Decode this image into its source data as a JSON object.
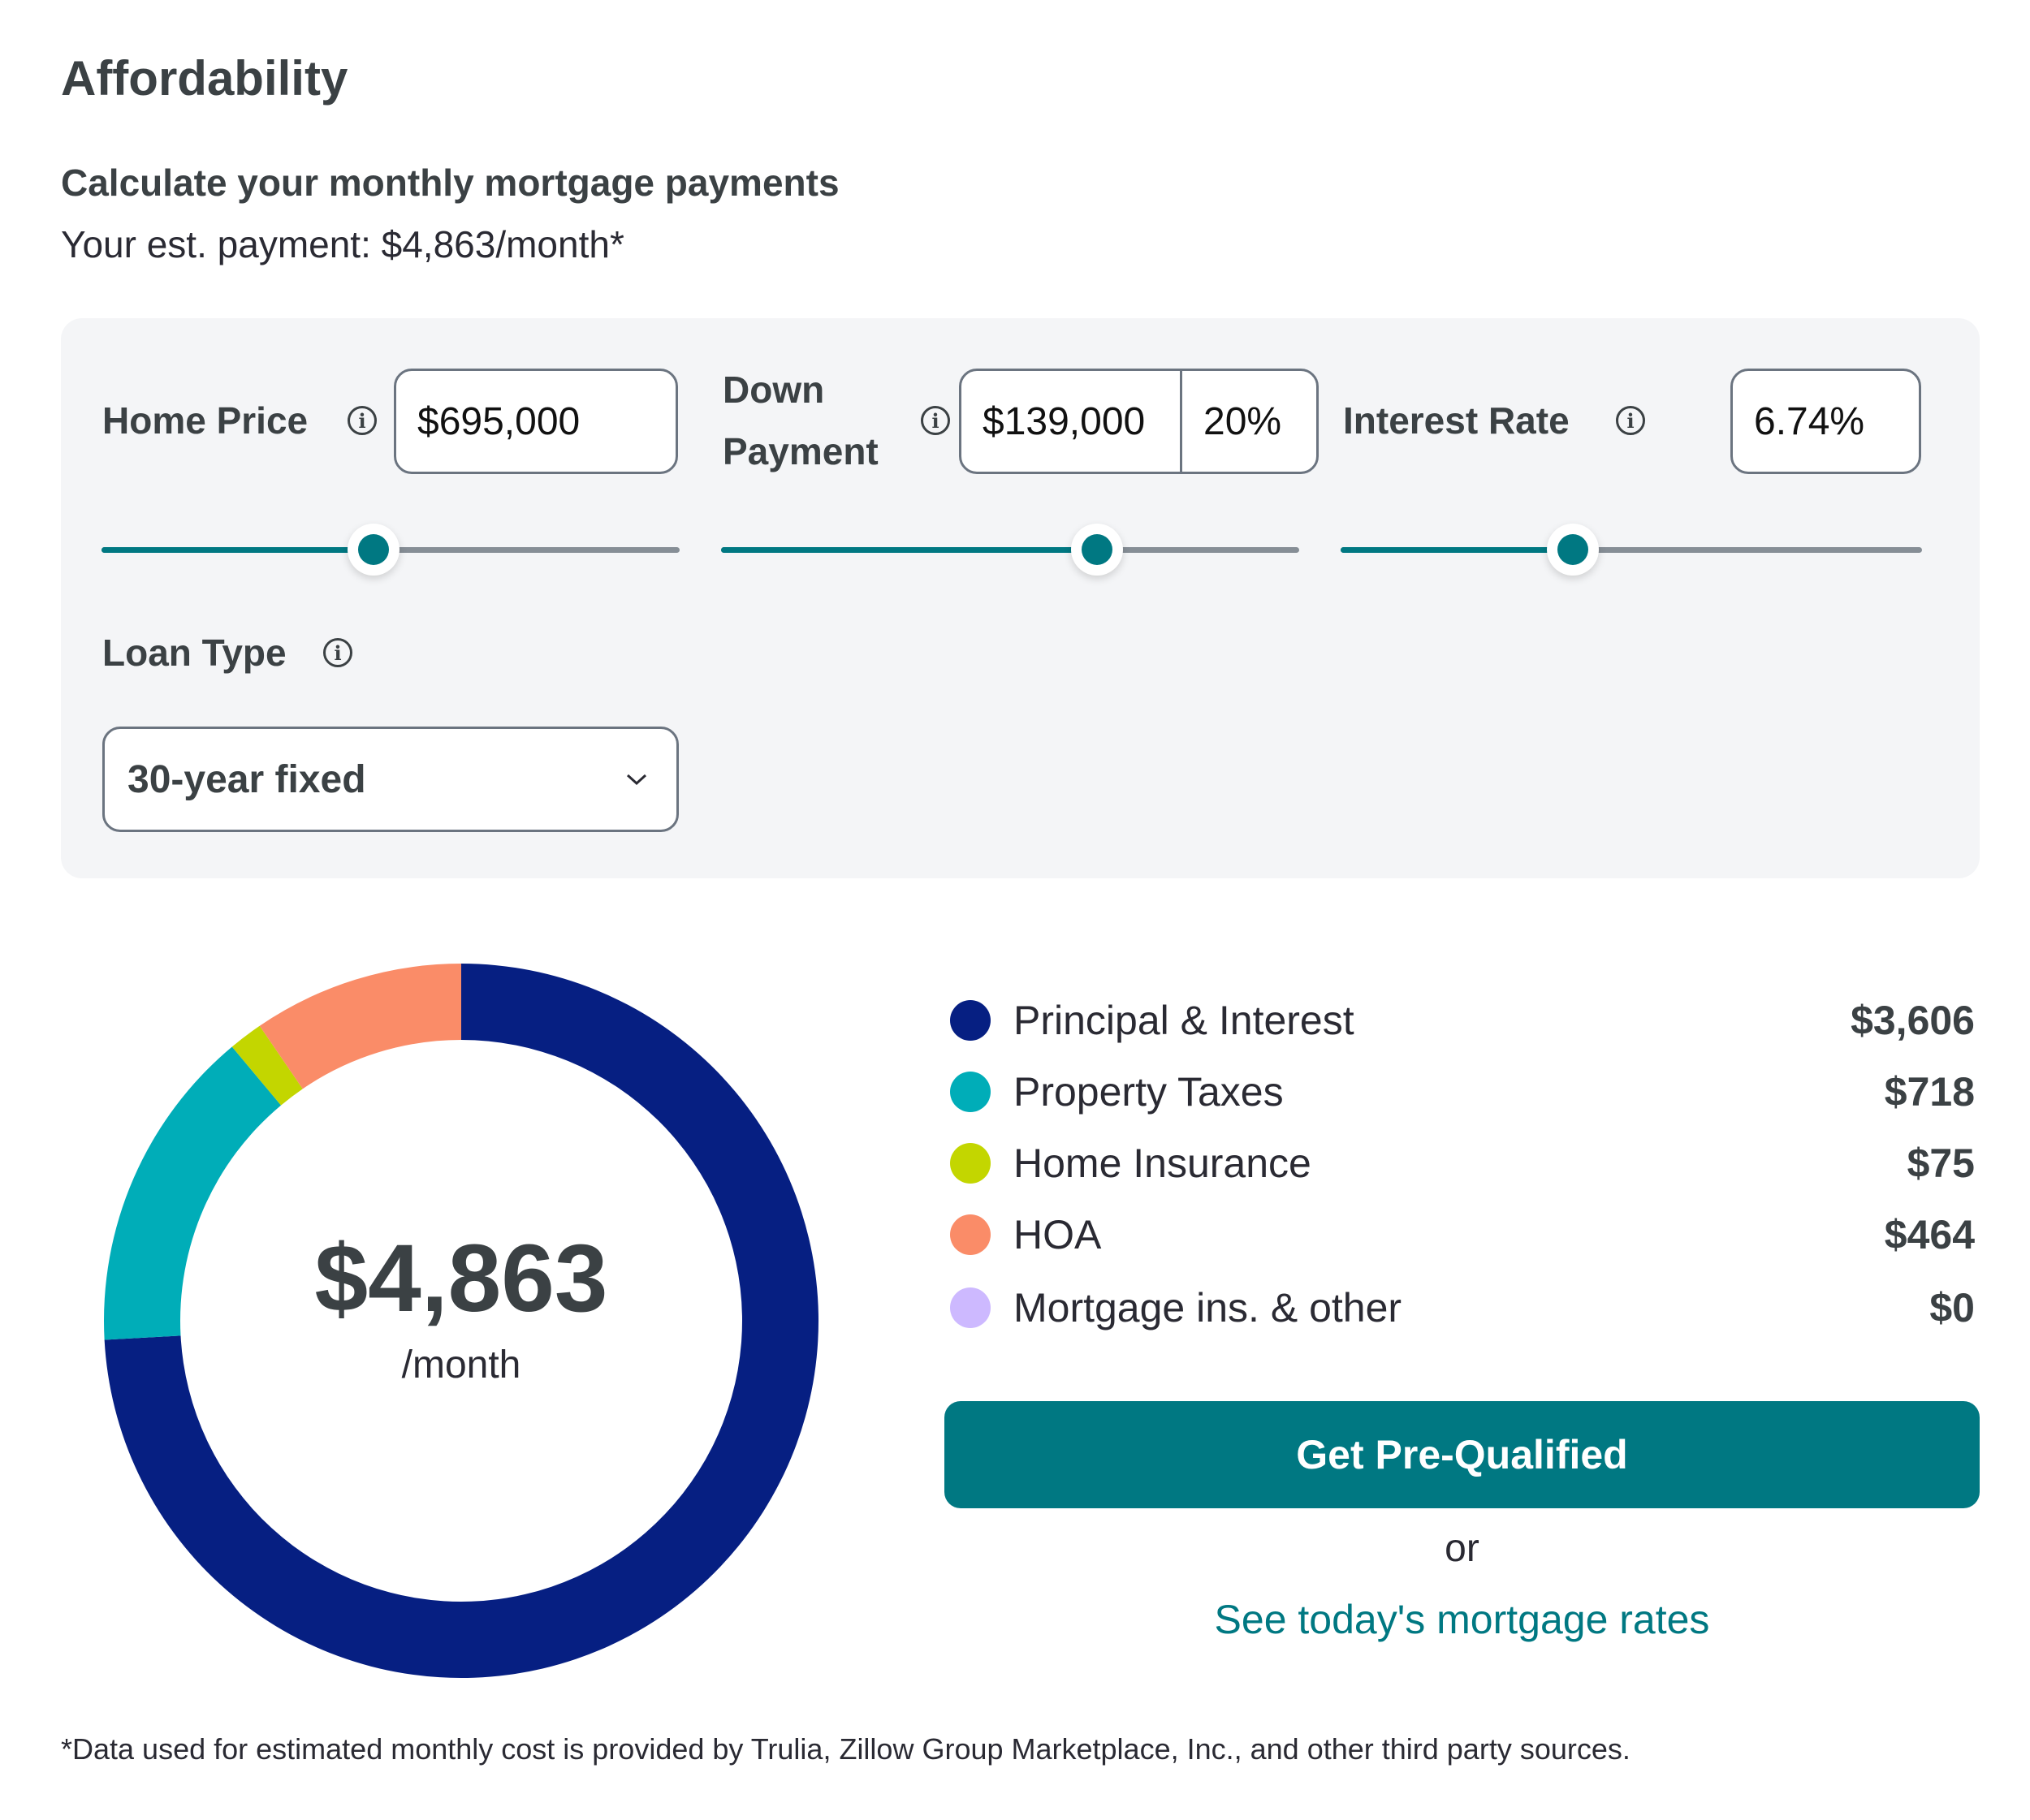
{
  "header": {
    "title": "Affordability",
    "subtitle": "Calculate your monthly mortgage payments",
    "estimate": "Your est. payment: $4,863/month*"
  },
  "form": {
    "home_price": {
      "label": "Home Price",
      "value": "$695,000",
      "slider_fraction": 0.47
    },
    "down_payment": {
      "label_line1": "Down",
      "label_line2": "Payment",
      "amount": "$139,000",
      "percent": "20%",
      "slider_fraction": 0.65
    },
    "interest_rate": {
      "label": "Interest Rate",
      "value": "6.74%",
      "slider_fraction": 0.4
    },
    "loan_type": {
      "label": "Loan Type",
      "selected": "30-year fixed"
    },
    "info_glyph": "i"
  },
  "summary": {
    "total": "$4,863",
    "per": "/month",
    "cta_label": "Get Pre-Qualified",
    "or_text": "or",
    "rates_link": "See today's mortgage rates"
  },
  "chart_data": {
    "type": "pie",
    "variant": "donut",
    "title": "$4,863 /month",
    "categories": [
      "Principal & Interest",
      "Property Taxes",
      "Home Insurance",
      "HOA",
      "Mortgage ins. & other"
    ],
    "values": [
      3606,
      718,
      75,
      464,
      0
    ],
    "display_values": [
      "$3,606",
      "$718",
      "$75",
      "$464",
      "$0"
    ],
    "colors": [
      "#061f82",
      "#00adb8",
      "#c3d600",
      "#fa8c68",
      "#cdb9ff"
    ],
    "start_angle": "12 o'clock",
    "direction": "clockwise",
    "legend_position": "right"
  },
  "footer": {
    "disclaimer": "*Data used for estimated monthly cost is provided by Trulia, Zillow Group Marketplace, Inc., and other third party sources."
  }
}
